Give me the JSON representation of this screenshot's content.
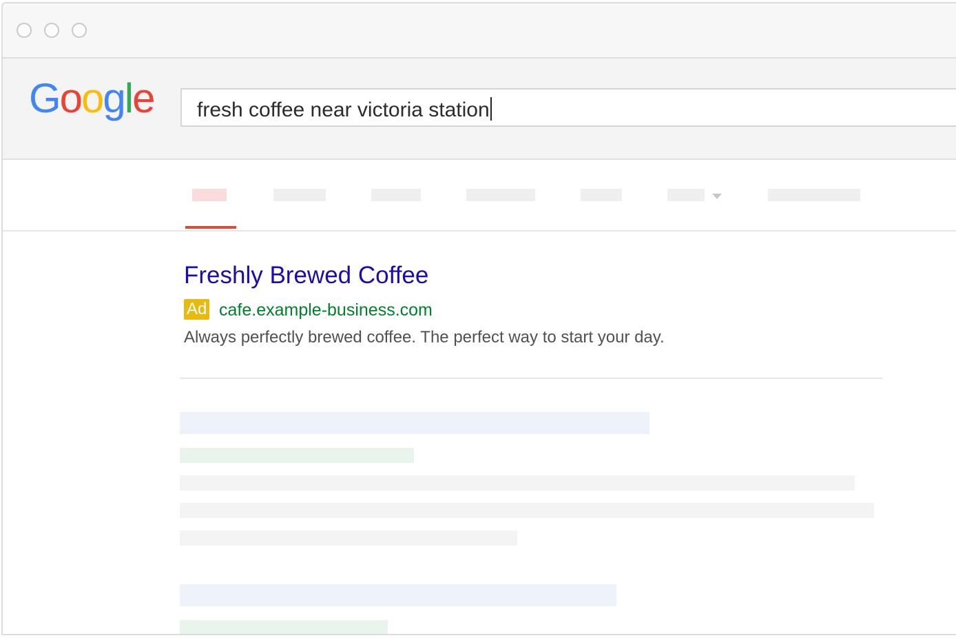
{
  "browser": {
    "traffic_lights": [
      "close",
      "minimize",
      "zoom"
    ]
  },
  "search": {
    "logo_letters": [
      {
        "char": "G",
        "color": "#4285F4"
      },
      {
        "char": "o",
        "color": "#EA4335"
      },
      {
        "char": "o",
        "color": "#FBBC05"
      },
      {
        "char": "g",
        "color": "#4285F4"
      },
      {
        "char": "l",
        "color": "#34A853"
      },
      {
        "char": "e",
        "color": "#EA4335"
      }
    ],
    "query": "fresh coffee near victoria station"
  },
  "tabs": {
    "count": 7,
    "active_index": 0,
    "active_color": "#dd4b39"
  },
  "ad": {
    "title": "Freshly Brewed Coffee",
    "badge": "Ad",
    "url": "cafe.example-business.com",
    "description": "Always perfectly brewed coffee. The perfect way to start your day.",
    "title_color": "#1a0dab",
    "url_color": "#00802b",
    "badge_color": "#e8b90e"
  }
}
